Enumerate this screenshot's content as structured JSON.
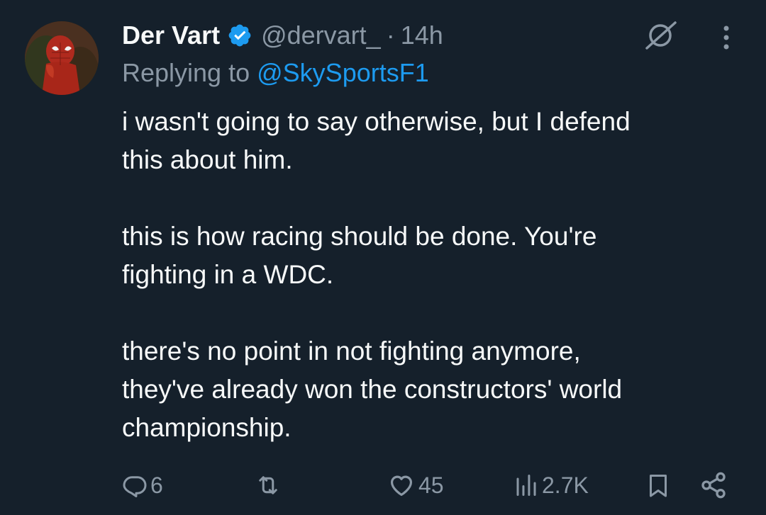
{
  "tweet": {
    "display_name": "Der Vart",
    "handle": "@dervart_",
    "separator": "·",
    "time": "14h",
    "replying_prefix": "Replying to",
    "replying_to": "@SkySportsF1",
    "body": [
      "i wasn't going to say otherwise, but I defend",
      "this about him.",
      "",
      "this is how racing should be done. You're",
      "fighting in a WDC.",
      "",
      "there's no point in not fighting anymore,",
      "they've already won the constructors' world",
      "championship."
    ]
  },
  "actions": {
    "replies": "6",
    "retweets": "",
    "likes": "45",
    "views": "2.7K"
  },
  "colors": {
    "background": "#15202b",
    "primary_text": "#f7f9f9",
    "secondary_text": "#8b98a5",
    "accent": "#1d9bf0"
  },
  "icons": {
    "verified": "verified-badge-icon",
    "grok": "grok-icon",
    "more": "more-vertical-icon",
    "reply": "reply-icon",
    "retweet": "retweet-icon",
    "like": "heart-icon",
    "views": "views-chart-icon",
    "bookmark": "bookmark-icon",
    "share": "share-icon"
  }
}
